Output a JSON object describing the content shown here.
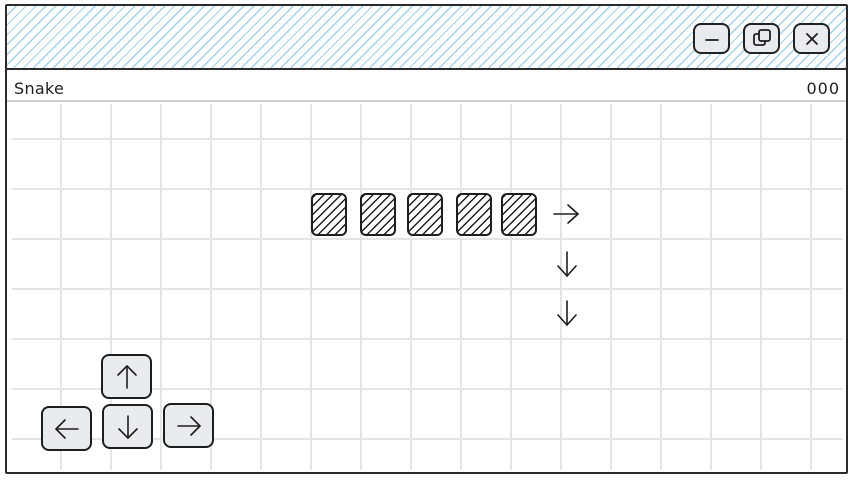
{
  "window": {
    "controls": [
      "minimize-icon",
      "restore-icon",
      "close-icon"
    ]
  },
  "game": {
    "title": "Snake",
    "score": "000",
    "snake_length": 5,
    "direction_hints": [
      "arrow-right-icon",
      "arrow-down-icon",
      "arrow-down-icon"
    ]
  },
  "controls": {
    "dpad": [
      "arrow-up-icon",
      "arrow-left-icon",
      "arrow-down-icon",
      "arrow-right-icon"
    ]
  },
  "colors": {
    "titlebar_hatch": "#9fd3ee",
    "grid_line": "#e3e6e9",
    "button_fill": "#e9ecef",
    "ink": "#1e1e1e"
  }
}
